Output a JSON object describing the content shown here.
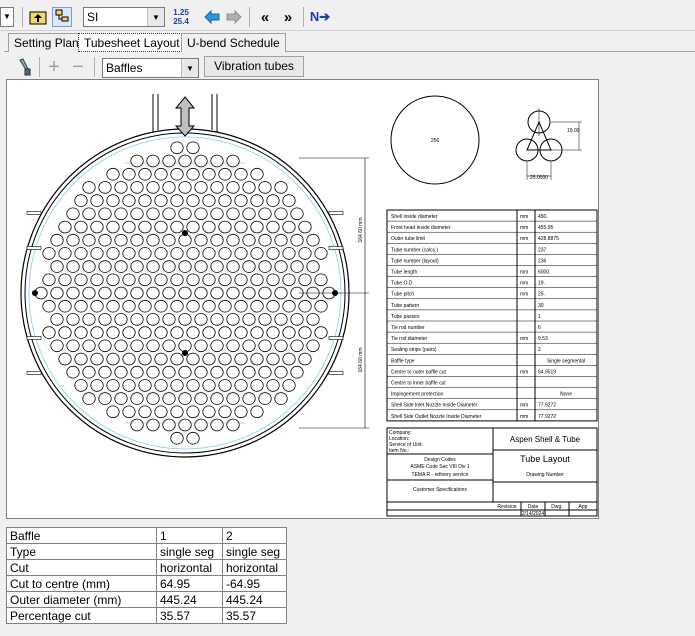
{
  "toolbar": {
    "unit_select": "SI",
    "unit_btn_top": "1.25",
    "unit_btn_bottom": "25.4",
    "buttons": [
      "back-icon",
      "forward-icon",
      "first-icon",
      "last-icon",
      "next-icon"
    ]
  },
  "tabs": [
    {
      "label": "Setting Plan"
    },
    {
      "label": "Tubesheet Layout"
    },
    {
      "label": "U-bend Schedule"
    }
  ],
  "subtoolbar": {
    "select_value": "Baffles",
    "vibration_button": "Vibration tubes"
  },
  "drawing": {
    "circle_label": "256",
    "pitch_label_1": "19.00",
    "pitch_label_2": "25.0000",
    "dim_label_1": "164.60 mm",
    "dim_label_2": "164.60 mm",
    "props": [
      {
        "name": "Shell inside diameter",
        "unit": "mm",
        "val": "450."
      },
      {
        "name": "Front head inside diameter",
        "unit": "mm",
        "val": "455.95"
      },
      {
        "name": "Outer tube limit",
        "unit": "mm",
        "val": "428.8875"
      },
      {
        "name": "Tube number (calcs.)",
        "unit": "",
        "val": "237"
      },
      {
        "name": "Tube number (layout)",
        "unit": "",
        "val": "236"
      },
      {
        "name": "Tube length",
        "unit": "mm",
        "val": "6000."
      },
      {
        "name": "Tube O.D.",
        "unit": "mm",
        "val": "19."
      },
      {
        "name": "Tube pitch",
        "unit": "mm",
        "val": "25."
      },
      {
        "name": "Tube pattern",
        "unit": "",
        "val": "30"
      },
      {
        "name": "Tube passes",
        "unit": "",
        "val": "1"
      },
      {
        "name": "Tie rod number",
        "unit": "",
        "val": "6"
      },
      {
        "name": "Tie rod diameter",
        "unit": "mm",
        "val": "9.53"
      },
      {
        "name": "Sealing strips (pairs)",
        "unit": "",
        "val": "2"
      },
      {
        "name": "Baffle type",
        "unit": "",
        "val": "Single segmental"
      },
      {
        "name": "Centre to outer baffle cut",
        "unit": "mm",
        "val": "64.9519"
      },
      {
        "name": "Centre to inner baffle cut",
        "unit": "",
        "val": ""
      },
      {
        "name": "Impingement protection",
        "unit": "",
        "val": "None"
      },
      {
        "name": "Shell Side Inlet Nozzle Inside Diameter",
        "unit": "mm",
        "val": "77.9272"
      },
      {
        "name": "Shell Side Outlet Nozzle Inside Diameter",
        "unit": "mm",
        "val": "77.9272"
      }
    ],
    "title_block": {
      "company": "Company:",
      "location": "Location:",
      "service": "Service of Unit:",
      "item": "Item No.:",
      "design_codes": "Design Codes",
      "asme": "ASME Code Sec VIII Div 1",
      "tema": "TEMA R - refinery service",
      "customer": "Customer Specifications",
      "product": "Aspen Shell & Tube",
      "title": "Tube Layout",
      "drawing_number": "Drawing Number",
      "revision": "Revision",
      "date": "Date",
      "dwg": "Dwg.",
      "app": "App",
      "date_val": "2/14/2024"
    }
  },
  "results": {
    "rows": [
      [
        "Baffle",
        "1",
        "2"
      ],
      [
        "Type",
        "single seg",
        "single seg"
      ],
      [
        "Cut",
        "horizontal",
        "horizontal"
      ],
      [
        "Cut to centre (mm)",
        "64.95",
        "-64.95"
      ],
      [
        "Outer diameter (mm)",
        "445.24",
        "445.24"
      ],
      [
        "Percentage cut",
        "35.57",
        "35.57"
      ]
    ]
  }
}
